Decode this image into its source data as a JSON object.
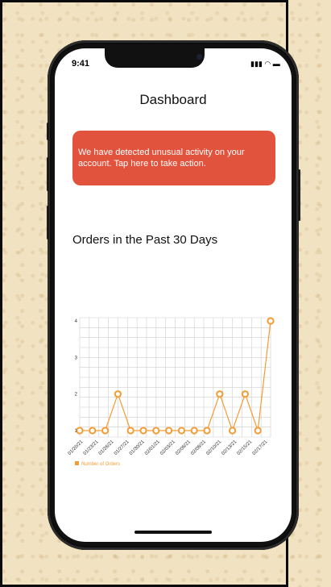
{
  "status_bar": {
    "time": "9:41",
    "icons": "▮▮▮ ◠ ▬"
  },
  "header": {
    "title": "Dashboard"
  },
  "alert": {
    "message": "We have detected unusual activity on your account. Tap here to take action."
  },
  "section": {
    "title": "Orders in the Past 30 Days"
  },
  "colors": {
    "accent": "#f39c35",
    "alert": "#e2533d"
  },
  "chart_data": {
    "type": "line",
    "title": "",
    "ylim": [
      1,
      4
    ],
    "yticks": [
      "1",
      "2",
      "3",
      "4"
    ],
    "x_labels": [
      "01/20/21",
      "01/23/21",
      "01/26/21",
      "01/27/21",
      "01/30/21",
      "02/01/21",
      "02/03/21",
      "02/06/21",
      "02/08/21",
      "02/10/21",
      "02/13/21",
      "02/15/21",
      "02/17/21"
    ],
    "series": [
      {
        "name": "Number of Orders",
        "values": [
          1,
          1,
          1,
          2,
          1,
          1,
          1,
          1,
          1,
          1,
          1,
          2,
          1,
          2,
          1,
          4
        ]
      }
    ],
    "legend": "bottom-left",
    "grid": true
  }
}
